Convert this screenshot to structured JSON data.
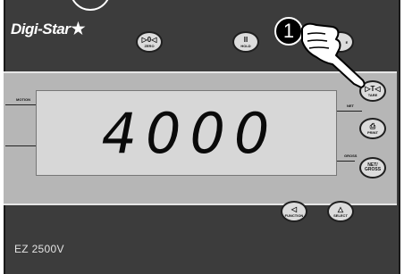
{
  "brand": {
    "name": "Digi-Star",
    "star": "★"
  },
  "display": {
    "weight": "4000"
  },
  "indicators": {
    "motion": "MOTION",
    "net": "NET",
    "gross": "GROSS"
  },
  "buttons": {
    "zero": {
      "symbol": "▷0◁",
      "label": "ZERO"
    },
    "hold": {
      "symbol": "II",
      "label": "HOLD"
    },
    "hidden": {
      "label": "E"
    },
    "tare": {
      "symbol": "▷T◁",
      "label": "TARE"
    },
    "print": {
      "symbol": "⎙",
      "label": "PRINT"
    },
    "net_gross": {
      "symbol": "NET/",
      "label": "GROSS"
    },
    "function": {
      "symbol": "◁",
      "label": "FUNCTION"
    },
    "select": {
      "symbol": "△",
      "label": "SELECT"
    }
  },
  "model": "EZ 2500V",
  "callout": {
    "number": "1"
  },
  "colors": {
    "panel": "#3c3c3c",
    "band": "#b6b6b6",
    "lcd": "#d7d7d7",
    "button": "#dcdcdc"
  }
}
